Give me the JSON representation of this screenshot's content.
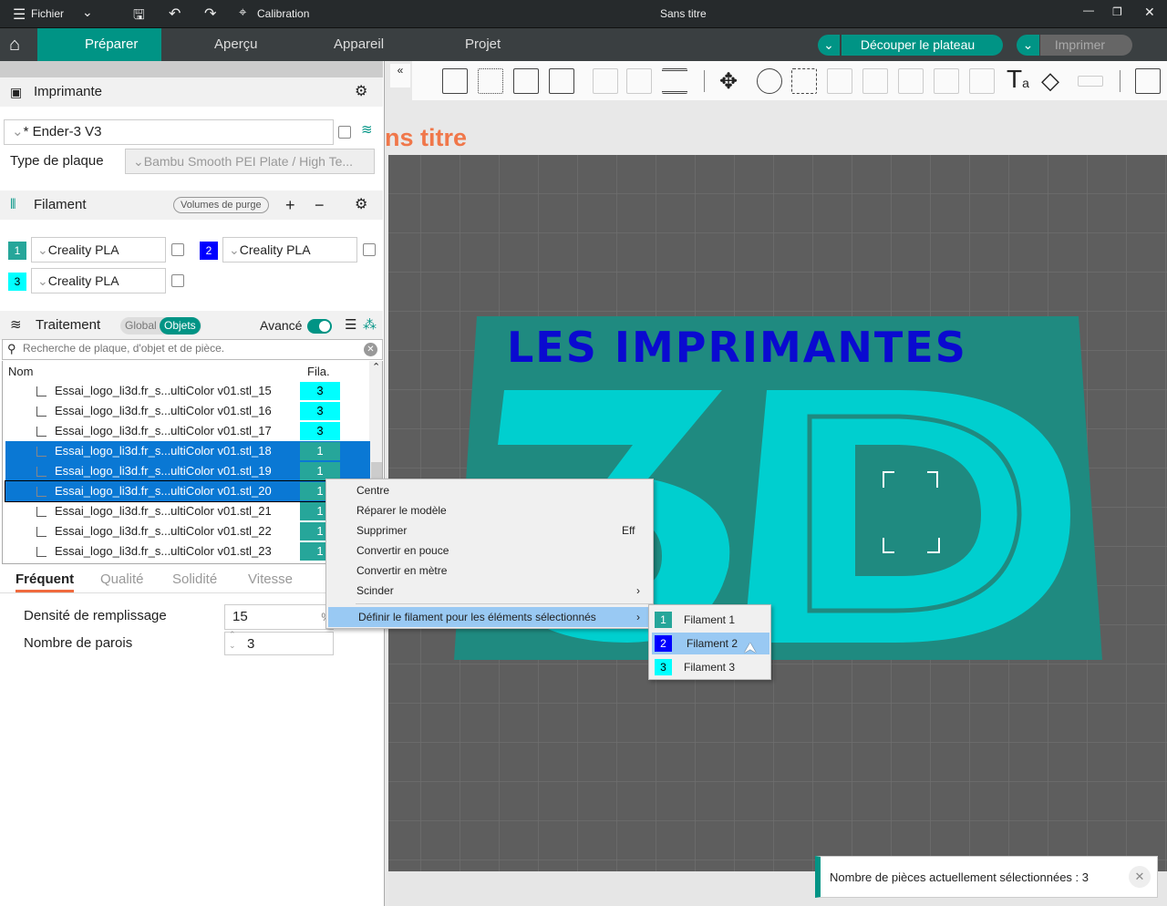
{
  "titlebar": {
    "menu": "Fichier",
    "calibration": "Calibration",
    "title": "Sans titre"
  },
  "nav": {
    "tabs": [
      {
        "label": "Préparer",
        "active": true
      },
      {
        "label": "Aperçu"
      },
      {
        "label": "Appareil"
      },
      {
        "label": "Projet"
      }
    ],
    "slice": "Découper le plateau",
    "print": "Imprimer"
  },
  "printer": {
    "header": "Imprimante",
    "name": "* Ender-3 V3",
    "plate_label": "Type de plaque",
    "plate_value": "Bambu Smooth PEI Plate / High Te..."
  },
  "filament": {
    "header": "Filament",
    "purge": "Volumes de purge",
    "items": [
      {
        "num": "1",
        "name": "Creality  PLA",
        "color": "#26a69a"
      },
      {
        "num": "2",
        "name": "Creality  PLA",
        "color": "#0000ff"
      },
      {
        "num": "3",
        "name": "Creality  PLA",
        "color": "#00ffff"
      }
    ]
  },
  "process": {
    "header": "Traitement",
    "global": "Global",
    "objects": "Objets",
    "advanced": "Avancé",
    "advanced_on": true,
    "search_placeholder": "Recherche de plaque, d'objet et de pièce."
  },
  "objects": {
    "col_name": "Nom",
    "col_fila": "Fila.",
    "rows": [
      {
        "name": "Essai_logo_li3d.fr_s...ultiColor v01.stl_15",
        "fila": "3",
        "selected": false
      },
      {
        "name": "Essai_logo_li3d.fr_s...ultiColor v01.stl_16",
        "fila": "3",
        "selected": false
      },
      {
        "name": "Essai_logo_li3d.fr_s...ultiColor v01.stl_17",
        "fila": "3",
        "selected": false
      },
      {
        "name": "Essai_logo_li3d.fr_s...ultiColor v01.stl_18",
        "fila": "1",
        "selected": true
      },
      {
        "name": "Essai_logo_li3d.fr_s...ultiColor v01.stl_19",
        "fila": "1",
        "selected": true
      },
      {
        "name": "Essai_logo_li3d.fr_s...ultiColor v01.stl_20",
        "fila": "1",
        "selected": true
      },
      {
        "name": "Essai_logo_li3d.fr_s...ultiColor v01.stl_21",
        "fila": "1",
        "selected": false
      },
      {
        "name": "Essai_logo_li3d.fr_s...ultiColor v01.stl_22",
        "fila": "1",
        "selected": false
      },
      {
        "name": "Essai_logo_li3d.fr_s...ultiColor v01.stl_23",
        "fila": "1",
        "selected": false
      }
    ]
  },
  "settings": {
    "tabs": [
      "Fréquent",
      "Qualité",
      "Solidité",
      "Vitesse"
    ],
    "infill_label": "Densité de remplissage",
    "infill_value": "15",
    "infill_unit": "%",
    "walls_label": "Nombre de parois",
    "walls_value": "3"
  },
  "plate": {
    "name": "ns titre",
    "text_top": "LES IMPRIMANTES",
    "text_big": "3D"
  },
  "context_menu": {
    "items": [
      "Centre",
      "Réparer le modèle",
      "Supprimer",
      "Convertir en pouce",
      "Convertir en mètre",
      "Scinder"
    ],
    "delete_shortcut": "Eff",
    "set_filament": "Définir le filament pour les éléments sélectionnés"
  },
  "submenu": {
    "items": [
      {
        "num": "1",
        "label": "Filament 1",
        "color": "#26a69a"
      },
      {
        "num": "2",
        "label": "Filament 2",
        "color": "#0000ff",
        "hover": true
      },
      {
        "num": "3",
        "label": "Filament 3",
        "color": "#00ffff"
      }
    ]
  },
  "notification": {
    "text": "Nombre de pièces actuellement sélectionnées : 3"
  },
  "colors": {
    "accent": "#009485",
    "selection": "#0a78d4",
    "plate": "#1f8a80"
  }
}
